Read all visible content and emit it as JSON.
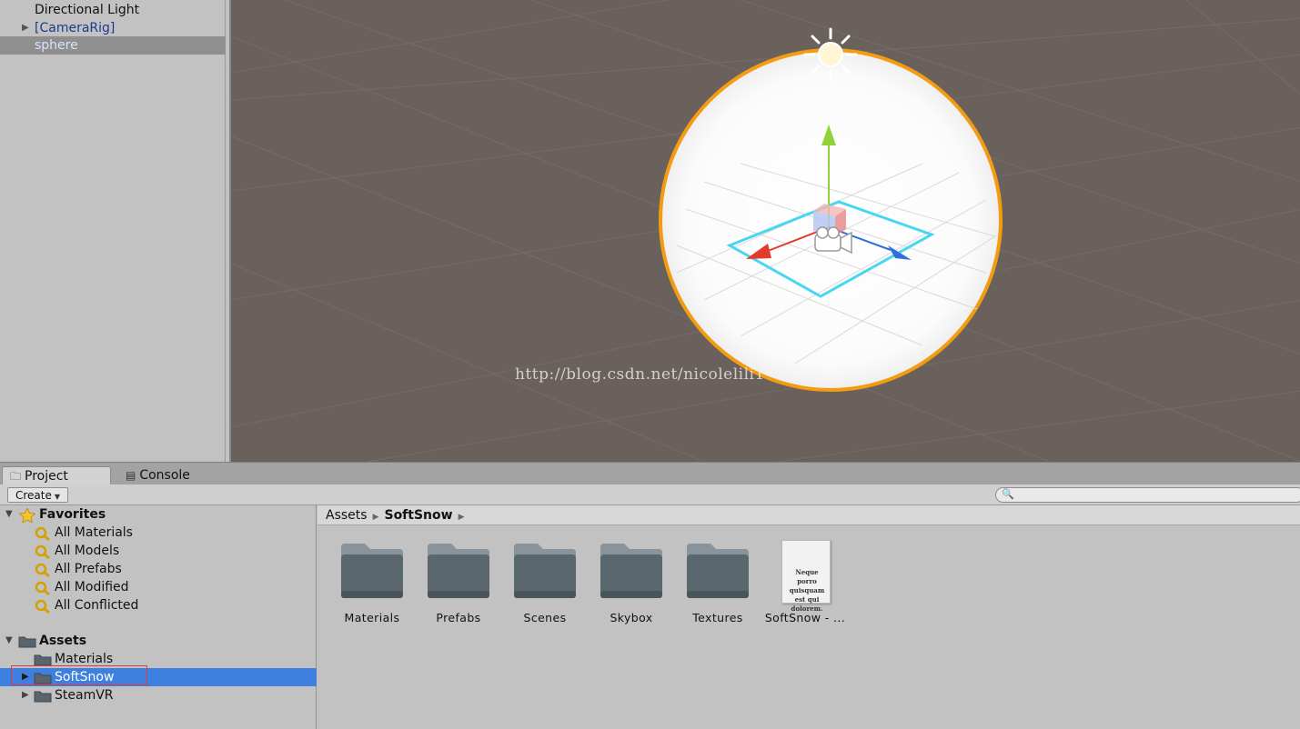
{
  "hierarchy": {
    "items": [
      {
        "label": "Directional Light"
      },
      {
        "label": "[CameraRig]"
      },
      {
        "label": "sphere"
      }
    ]
  },
  "scene": {
    "watermark": "http://blog.csdn.net/nicolelili1",
    "colors": {
      "background": "#6a615d",
      "sphere_outline": "#f39c12",
      "gizmo_x": "#e23b2b",
      "gizmo_y": "#8fd339",
      "gizmo_z": "#2f6fe0",
      "selection_rect": "#49d6f0"
    }
  },
  "tabs": [
    {
      "label": "Project",
      "icon": "folder-icon"
    },
    {
      "label": "Console",
      "icon": "console-icon"
    }
  ],
  "toolbar": {
    "create_label": "Create",
    "search_placeholder": ""
  },
  "tree": {
    "favorites": {
      "label": "Favorites",
      "items": [
        {
          "label": "All Materials"
        },
        {
          "label": "All Models"
        },
        {
          "label": "All Prefabs"
        },
        {
          "label": "All Modified"
        },
        {
          "label": "All Conflicted"
        }
      ]
    },
    "assets": {
      "label": "Assets",
      "items": [
        {
          "label": "Materials"
        },
        {
          "label": "SoftSnow"
        },
        {
          "label": "SteamVR"
        }
      ]
    }
  },
  "breadcrumb": {
    "root": "Assets",
    "current": "SoftSnow"
  },
  "asset_grid": {
    "items": [
      {
        "label": "Materials",
        "kind": "folder"
      },
      {
        "label": "Prefabs",
        "kind": "folder"
      },
      {
        "label": "Scenes",
        "kind": "folder"
      },
      {
        "label": "Skybox",
        "kind": "folder"
      },
      {
        "label": "Textures",
        "kind": "folder"
      },
      {
        "label": "SoftSnow - ...",
        "kind": "document",
        "preview_text": "Neque porro quisquam est qui dolorem."
      }
    ]
  },
  "colors": {
    "selection_blue": "#3d80df",
    "outline_red": "#e03a3a",
    "prefab_text": "#1a3b8c"
  }
}
